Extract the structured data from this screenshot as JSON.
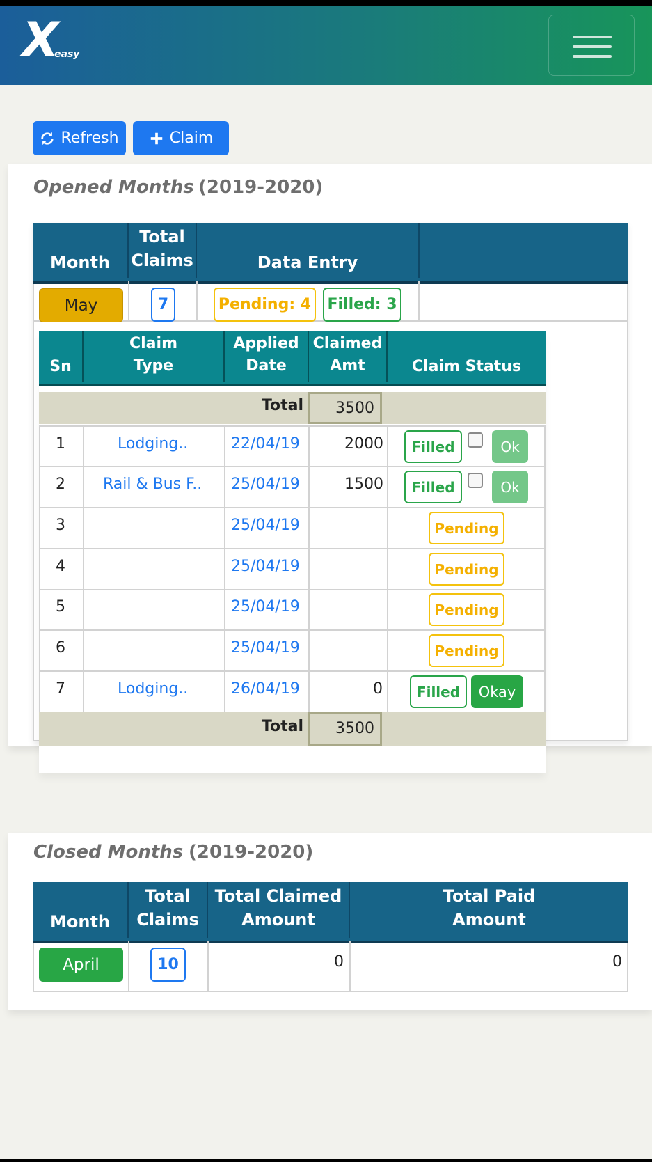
{
  "app": {
    "logo_mark": "X",
    "logo_text": "easy"
  },
  "toolbar": {
    "refresh_label": "Refresh",
    "claim_label": "Claim"
  },
  "opened": {
    "title": "Opened Months",
    "year": "(2019-2020)",
    "headers": {
      "month": "Month",
      "total_claims_1": "Total",
      "total_claims_2": "Claims",
      "data_entry": "Data Entry"
    },
    "row": {
      "month": "May",
      "total_claims": "7",
      "pending": "Pending: 4",
      "filled": "Filled: 3"
    },
    "detail": {
      "headers": {
        "sn": "Sn",
        "claim_type_1": "Claim",
        "claim_type_2": "Type",
        "applied_1": "Applied",
        "applied_2": "Date",
        "claimed_1": "Claimed",
        "claimed_2": "Amt",
        "status": "Claim Status"
      },
      "total_label": "Total",
      "total_value": "3500",
      "rows": [
        {
          "sn": "1",
          "type": "Lodging..",
          "date": "22/04/19",
          "amt": "2000",
          "status": "Filled",
          "action": "Ok"
        },
        {
          "sn": "2",
          "type": "Rail & Bus F..",
          "date": "25/04/19",
          "amt": "1500",
          "status": "Filled",
          "action": "Ok"
        },
        {
          "sn": "3",
          "type": "",
          "date": "25/04/19",
          "amt": "",
          "status": "Pending"
        },
        {
          "sn": "4",
          "type": "",
          "date": "25/04/19",
          "amt": "",
          "status": "Pending"
        },
        {
          "sn": "5",
          "type": "",
          "date": "25/04/19",
          "amt": "",
          "status": "Pending"
        },
        {
          "sn": "6",
          "type": "",
          "date": "25/04/19",
          "amt": "",
          "status": "Pending"
        },
        {
          "sn": "7",
          "type": "Lodging..",
          "date": "26/04/19",
          "amt": "0",
          "status": "Filled",
          "action": "Okay"
        }
      ]
    }
  },
  "closed": {
    "title": "Closed Months",
    "year": "(2019-2020)",
    "headers": {
      "month": "Month",
      "total_claims_1": "Total",
      "total_claims_2": "Claims",
      "claimed_1": "Total Claimed",
      "claimed_2": "Amount",
      "paid_1": "Total Paid",
      "paid_2": "Amount"
    },
    "row": {
      "month": "April",
      "total_claims": "10",
      "claimed": "0",
      "paid": "0"
    }
  },
  "colors": {
    "primary": "#1e78f0",
    "header": "#176488",
    "inner_header": "#0b878f",
    "warning": "#e3ab00",
    "success": "#28a645"
  }
}
